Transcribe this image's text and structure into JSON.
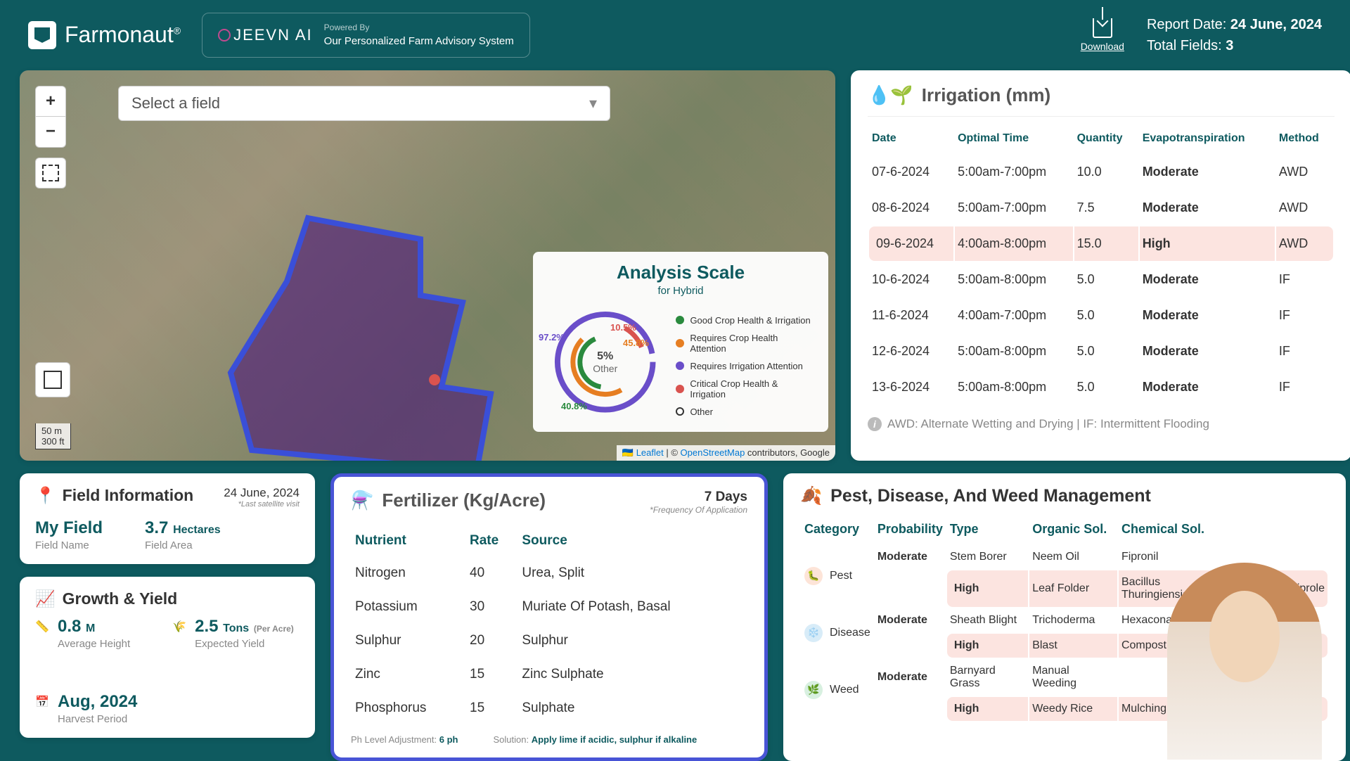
{
  "header": {
    "brand": "Farmonaut",
    "trademark": "®",
    "jeevn": "JEEVN AI",
    "powered_by": "Powered By",
    "tagline": "Our Personalized Farm Advisory System",
    "download": "Download",
    "report_date_label": "Report Date:",
    "report_date": "24 June, 2024",
    "total_fields_label": "Total Fields:",
    "total_fields": "3"
  },
  "map": {
    "select_placeholder": "Select a field",
    "scale_m": "50 m",
    "scale_ft": "300 ft",
    "attrib_leaflet": "Leaflet",
    "attrib_osm": "OpenStreetMap",
    "attrib_suffix": " contributors, Google",
    "analysis": {
      "title": "Analysis Scale",
      "subtitle": "for Hybrid",
      "center_pct": "5%",
      "center_label": "Other",
      "labels": {
        "l1": "97.2%",
        "l2": "10.5%",
        "l3": "45.8%",
        "l4": "40.8%"
      },
      "legend": {
        "good": "Good Crop Health & Irrigation",
        "crop_att": "Requires Crop Health Attention",
        "irr_att": "Requires Irrigation Attention",
        "critical": "Critical Crop Health & Irrigation",
        "other": "Other"
      }
    }
  },
  "irrigation": {
    "title": "Irrigation (mm)",
    "headers": {
      "date": "Date",
      "time": "Optimal Time",
      "qty": "Quantity",
      "evap": "Evapotranspiration",
      "method": "Method"
    },
    "rows": [
      {
        "date": "07-6-2024",
        "time": "5:00am-7:00pm",
        "qty": "10.0",
        "evap": "Moderate",
        "method": "AWD",
        "high": false
      },
      {
        "date": "08-6-2024",
        "time": "5:00am-7:00pm",
        "qty": "7.5",
        "evap": "Moderate",
        "method": "AWD",
        "high": false
      },
      {
        "date": "09-6-2024",
        "time": "4:00am-8:00pm",
        "qty": "15.0",
        "evap": "High",
        "method": "AWD",
        "high": true
      },
      {
        "date": "10-6-2024",
        "time": "5:00am-8:00pm",
        "qty": "5.0",
        "evap": "Moderate",
        "method": "IF",
        "high": false
      },
      {
        "date": "11-6-2024",
        "time": "4:00am-7:00pm",
        "qty": "5.0",
        "evap": "Moderate",
        "method": "IF",
        "high": false
      },
      {
        "date": "12-6-2024",
        "time": "5:00am-8:00pm",
        "qty": "5.0",
        "evap": "Moderate",
        "method": "IF",
        "high": false
      },
      {
        "date": "13-6-2024",
        "time": "5:00am-8:00pm",
        "qty": "5.0",
        "evap": "Moderate",
        "method": "IF",
        "high": false
      }
    ],
    "footnote": "AWD: Alternate Wetting and Drying | IF: Intermittent Flooding"
  },
  "fieldinfo": {
    "title": "Field Information",
    "date": "24 June, 2024",
    "date_note": "*Last satellite visit",
    "name_val": "My Field",
    "name_lbl": "Field Name",
    "area_val": "3.7",
    "area_unit": "Hectares",
    "area_lbl": "Field Area"
  },
  "growth": {
    "title": "Growth & Yield",
    "height_val": "0.8",
    "height_unit": "M",
    "height_lbl": "Average Height",
    "yield_val": "2.5",
    "yield_unit": "Tons",
    "yield_per": "(Per Acre)",
    "yield_lbl": "Expected Yield",
    "harvest_val": "Aug, 2024",
    "harvest_lbl": "Harvest Period"
  },
  "fertilizer": {
    "title": "Fertilizer (Kg/Acre)",
    "days": "7 Days",
    "days_note": "*Frequency Of Application",
    "headers": {
      "nutrient": "Nutrient",
      "rate": "Rate",
      "source": "Source"
    },
    "rows": [
      {
        "n": "Nitrogen",
        "r": "40",
        "s": "Urea, Split"
      },
      {
        "n": "Potassium",
        "r": "30",
        "s": "Muriate Of Potash, Basal"
      },
      {
        "n": "Sulphur",
        "r": "20",
        "s": "Sulphur"
      },
      {
        "n": "Zinc",
        "r": "15",
        "s": "Zinc Sulphate"
      },
      {
        "n": "Phosphorus",
        "r": "15",
        "s": "Sulphate"
      }
    ],
    "ph_label": "Ph Level Adjustment:",
    "ph_val": "6 ph",
    "sol_label": "Solution:",
    "sol_val": "Apply lime if acidic, sulphur if alkaline"
  },
  "pest": {
    "title": "Pest, Disease, And Weed Management",
    "headers": {
      "cat": "Category",
      "prob": "Probability",
      "type": "Type",
      "org": "Organic Sol.",
      "chem": "Chemical Sol."
    },
    "categories": {
      "pest": "Pest",
      "disease": "Disease",
      "weed": "Weed"
    },
    "rows": {
      "pest_m": {
        "prob": "Moderate",
        "type": "Stem Borer",
        "org": "Neem Oil",
        "chem": "Fipronil"
      },
      "pest_h": {
        "prob": "High",
        "type": "Leaf Folder",
        "org": "Bacillus Thuringiensis",
        "chem": "Chlorantraniliprole"
      },
      "dis_m": {
        "prob": "Moderate",
        "type": "Sheath Blight",
        "org": "Trichoderma",
        "chem": "Hexaconazole"
      },
      "dis_h": {
        "prob": "High",
        "type": "Blast",
        "org": "Compost Tea",
        "chem": ""
      },
      "weed_m": {
        "prob": "Moderate",
        "type": "Barnyard Grass",
        "org": "Manual Weeding",
        "chem": ""
      },
      "weed_h": {
        "prob": "High",
        "type": "Weedy Rice",
        "org": "Mulching",
        "chem": ""
      }
    }
  },
  "chart_data": {
    "type": "pie",
    "title": "Analysis Scale for Hybrid",
    "series": [
      {
        "name": "Good Crop Health & Irrigation",
        "value": 40.8,
        "color": "#2a8a3e"
      },
      {
        "name": "Requires Crop Health Attention",
        "value": 45.8,
        "color": "#e67e22"
      },
      {
        "name": "Requires Irrigation Attention",
        "value": 97.2,
        "color": "#6a4ec9"
      },
      {
        "name": "Critical Crop Health & Irrigation",
        "value": 10.5,
        "color": "#d9534f"
      },
      {
        "name": "Other",
        "value": 5,
        "color": "#ffffff"
      }
    ],
    "note": "Values are percentages shown on concentric rings; not a single pie summing to 100."
  }
}
